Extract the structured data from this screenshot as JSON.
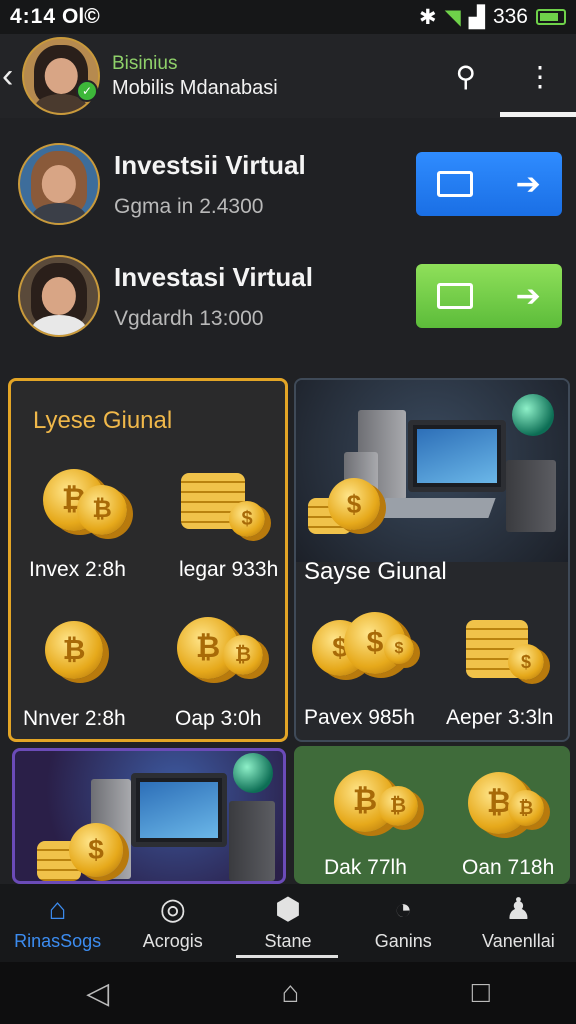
{
  "status_bar": {
    "time": "4:14",
    "extra": "Ol©",
    "battery_text": "336"
  },
  "header": {
    "subtitle": "Bisinius",
    "title": "Mobilis Mdanabasi"
  },
  "investments": [
    {
      "title": "Investsii Virtual",
      "subtitle": "Ggma in 2.4300",
      "button_color": "#2f8cff"
    },
    {
      "title": "Investasi Virtual",
      "subtitle": "Vgdardh 13:000",
      "button_color": "#8fe05a"
    }
  ],
  "cards": {
    "left_top": {
      "title": "Lyese Giunal",
      "items": [
        "Invex 2:8h",
        "legar 933h",
        "Nnver 2:8h",
        "Oap 3:0h"
      ]
    },
    "right_top": {
      "title": "Sayse Giunal",
      "items": [
        "Pavex 985h",
        "Aeper 3:3ln"
      ]
    },
    "right_bottom": {
      "items": [
        "Dak 77lh",
        "Oan 718h"
      ]
    }
  },
  "bottom_nav": [
    {
      "label": "RinasSogs",
      "icon": "home-icon",
      "active": true
    },
    {
      "label": "Acrogis",
      "icon": "target-icon",
      "active": false
    },
    {
      "label": "Stane",
      "icon": "box-icon",
      "active": false
    },
    {
      "label": "Ganins",
      "icon": "chart-icon",
      "active": false
    },
    {
      "label": "Vanenllai",
      "icon": "user-icon",
      "active": false
    }
  ]
}
